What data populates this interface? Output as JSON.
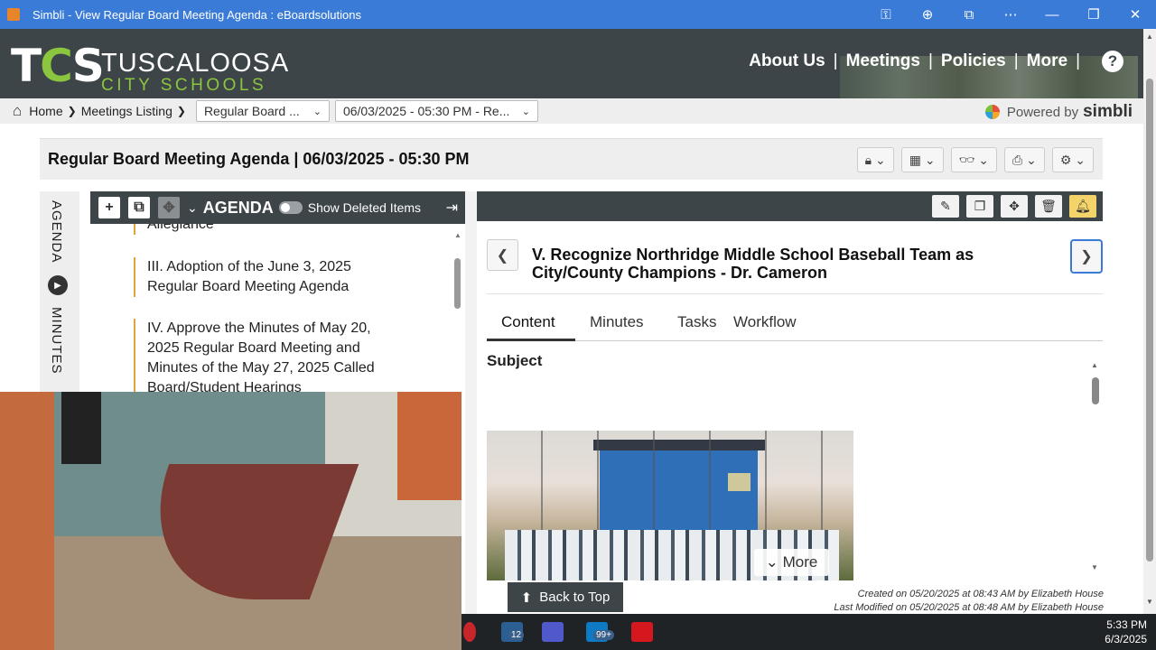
{
  "window": {
    "title": "Simbli - View Regular Board Meeting Agenda : eBoardsolutions"
  },
  "logo": {
    "initials_t": "T",
    "initials_c": "C",
    "initials_s": "S",
    "line1": "TUSCALOOSA",
    "line2": "CITY SCHOOLS"
  },
  "topnav": {
    "items": [
      "About Us",
      "Meetings",
      "Policies",
      "More"
    ],
    "help": "?"
  },
  "breadcrumb": {
    "home": "Home",
    "listing": "Meetings Listing",
    "meeting_type": "Regular Board ...",
    "meeting_date": "06/03/2025 - 05:30 PM - Re..."
  },
  "powered": {
    "label": "Powered by",
    "brand": "simbli"
  },
  "heading": {
    "title": "Regular Board Meeting Agenda | 06/03/2025 - 05:30 PM"
  },
  "sidetabs": {
    "agenda": "AGENDA",
    "minutes": "MINUTES"
  },
  "agenda_toolbar": {
    "label": "AGENDA",
    "show_deleted": "Show Deleted Items"
  },
  "agenda_items": [
    "Allegiance",
    "III. Adoption of the June 3, 2025 Regular Board Meeting Agenda",
    "IV. Approve the Minutes of May 20, 2025 Regular Board Meeting and Minutes of the May 27, 2025 Called Board/Student Hearings"
  ],
  "detail": {
    "item_title": "V. Recognize Northridge Middle School Baseball Team as City/County Champions - Dr. Cameron",
    "tabs": [
      "Content",
      "Minutes",
      "Tasks",
      "Workflow"
    ],
    "active_tab": "Content",
    "subject_label": "Subject",
    "more_label": "More",
    "created": "Created on 05/20/2025 at 08:43 AM by Elizabeth House",
    "modified": "Last Modified on 05/20/2025 at 08:48 AM by Elizabeth House"
  },
  "back_to_top": "Back to Top",
  "taskbar": {
    "badge_12": "12",
    "badge_99": "99+",
    "time": "5:33 PM",
    "date": "6/3/2025"
  },
  "colors": {
    "titlebar": "#3b7bd8",
    "banner": "#3d4548",
    "accent_green": "#8cc63f",
    "agenda_marker": "#e0a53a"
  }
}
